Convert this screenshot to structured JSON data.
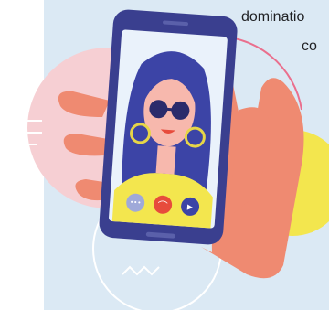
{
  "caption": {
    "line1": "dominatio",
    "line2": "co"
  },
  "call_controls": {
    "more_glyph": "•••",
    "end_call_glyph": "⌒",
    "video_glyph": "▶"
  },
  "colors": {
    "panel_bg": "#dbe9f4",
    "pink_circle": "#f6cfd3",
    "yellow_circle": "#f3e64e",
    "hand_skin": "#ef8a71",
    "phone_frame": "#3a3f8f",
    "screen_bg": "#eaf2fb",
    "hair": "#3c44a6",
    "face_skin": "#f7b8ad",
    "shirt": "#f3e64e",
    "sunglasses": "#2a2b6b",
    "earrings": "#e6d548",
    "end_call_button": "#e74b3c",
    "more_button": "#9fa9d9",
    "video_button": "#3c44a6"
  },
  "icons": [
    "more-dots-icon",
    "end-call-icon",
    "video-camera-icon"
  ]
}
